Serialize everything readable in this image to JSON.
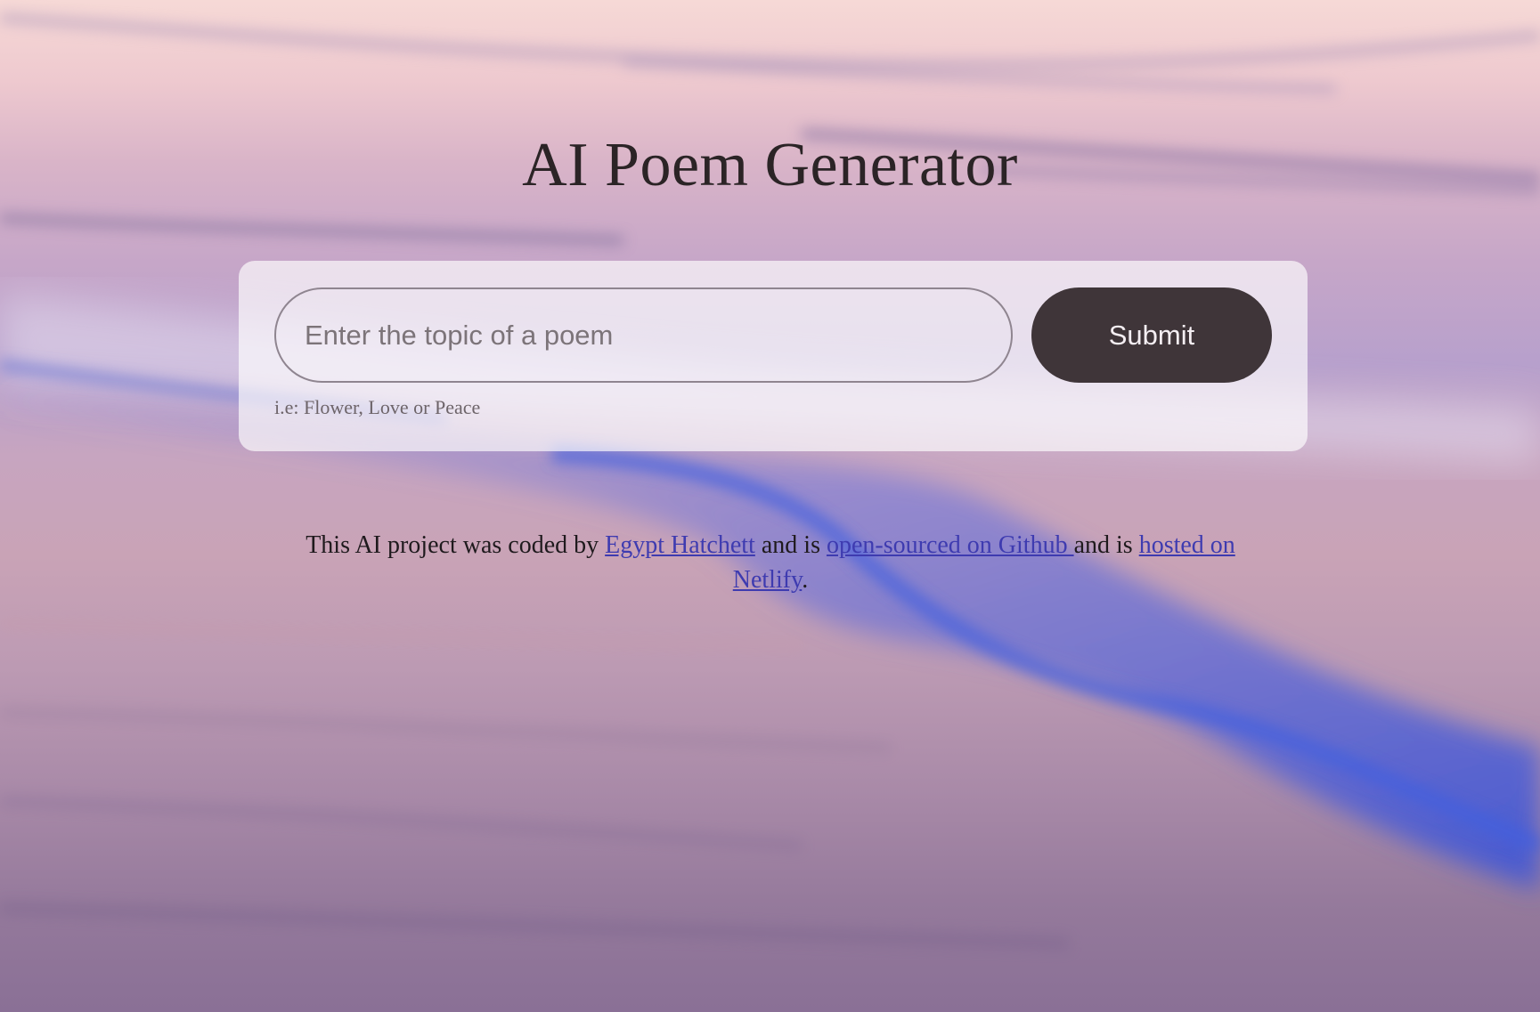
{
  "page": {
    "title": "AI Poem Generator"
  },
  "form": {
    "input_placeholder": "Enter the topic of a poem",
    "input_value": "",
    "submit_label": "Submit",
    "hint": "i.e: Flower, Love or Peace"
  },
  "footer": {
    "text_1": "This AI project was coded by ",
    "author_link": "Egypt Hatchett",
    "text_2": " and is ",
    "github_link": "open-sourced on Github ",
    "text_3": "and is ",
    "netlify_link": "hosted on Netlify",
    "text_4": "."
  },
  "colors": {
    "button_bg": "#3f3539",
    "link": "#3e3bb0",
    "title": "#2b2426"
  }
}
